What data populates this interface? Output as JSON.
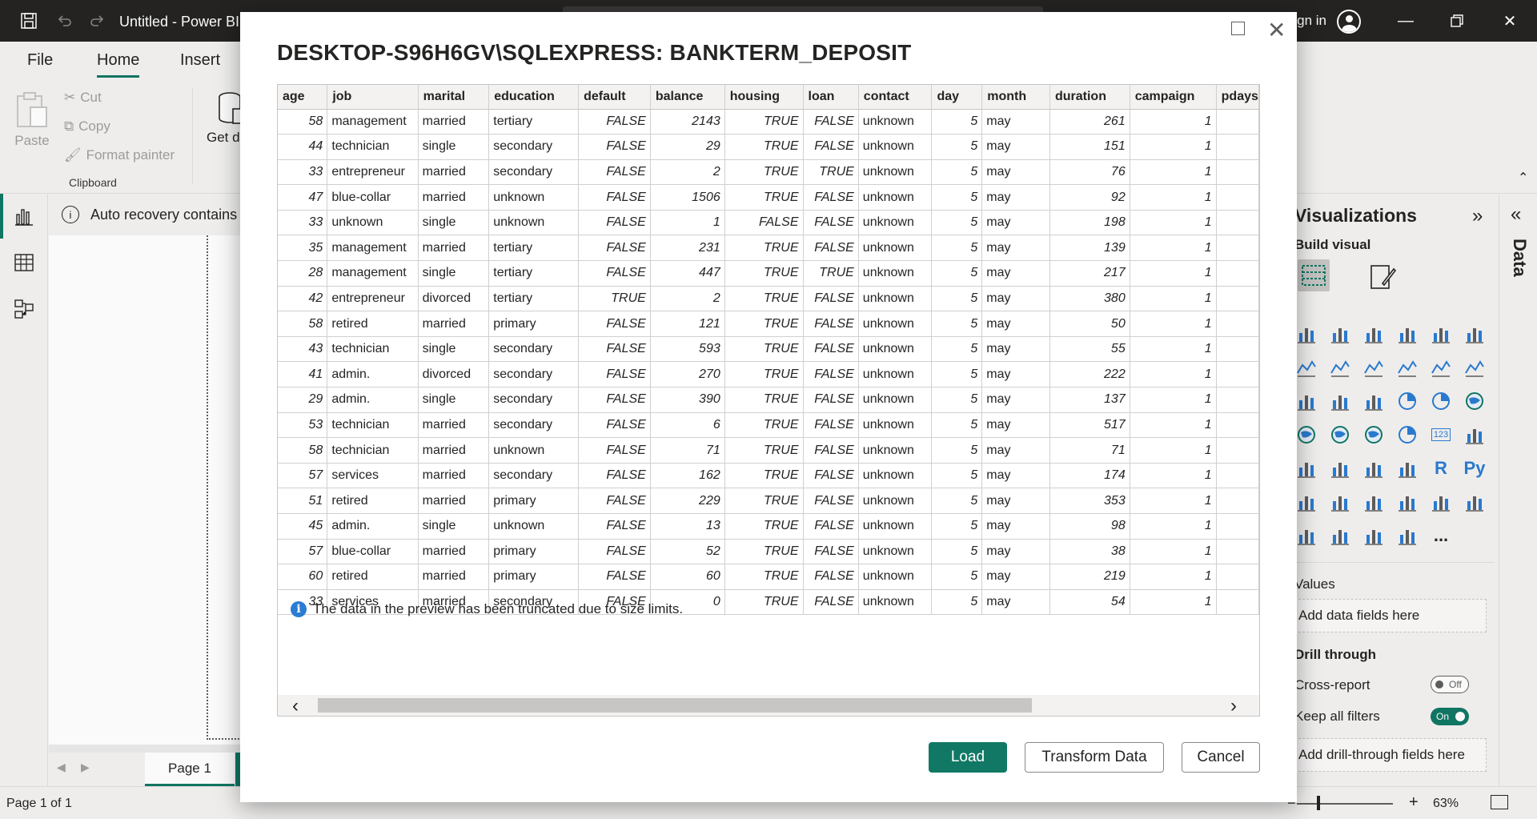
{
  "app": {
    "title": "Untitled - Power BI",
    "sign_in": "Sign in"
  },
  "ribbon": {
    "tabs": [
      "File",
      "Home",
      "Insert"
    ],
    "active_tab": "Home",
    "clipboard": {
      "paste": "Paste",
      "cut": "Cut",
      "copy": "Copy",
      "format_painter": "Format painter",
      "group_label": "Clipboard"
    },
    "get_data": "Get data"
  },
  "info_bar": {
    "text": "Auto recovery contains"
  },
  "pages": {
    "tabs": [
      "Page 1"
    ],
    "add_symbol": "+"
  },
  "status": {
    "page_count": "Page 1 of 1",
    "zoom": "63%"
  },
  "visualizations": {
    "title": "Visualizations",
    "build_visual": "Build visual",
    "values_label": "Values",
    "values_placeholder": "Add data fields here",
    "drill_through": "Drill through",
    "cross_report": "Cross-report",
    "cross_report_state": "Off",
    "keep_all_filters": "Keep all filters",
    "keep_all_filters_state": "On",
    "drill_placeholder": "Add drill-through fields here",
    "r_label": "R",
    "py_label": "Py",
    "more": "...",
    "num_icon": "123"
  },
  "data_pane": {
    "title": "Data"
  },
  "dialog": {
    "title": "DESKTOP-S96H6GV\\SQLEXPRESS: BANKTERM_DEPOSIT",
    "columns": [
      "age",
      "job",
      "marital",
      "education",
      "default",
      "balance",
      "housing",
      "loan",
      "contact",
      "day",
      "month",
      "duration",
      "campaign",
      "pdays"
    ],
    "rows": [
      [
        "58",
        "management",
        "married",
        "tertiary",
        "FALSE",
        "2143",
        "TRUE",
        "FALSE",
        "unknown",
        "5",
        "may",
        "261",
        "1",
        ""
      ],
      [
        "44",
        "technician",
        "single",
        "secondary",
        "FALSE",
        "29",
        "TRUE",
        "FALSE",
        "unknown",
        "5",
        "may",
        "151",
        "1",
        ""
      ],
      [
        "33",
        "entrepreneur",
        "married",
        "secondary",
        "FALSE",
        "2",
        "TRUE",
        "TRUE",
        "unknown",
        "5",
        "may",
        "76",
        "1",
        ""
      ],
      [
        "47",
        "blue-collar",
        "married",
        "unknown",
        "FALSE",
        "1506",
        "TRUE",
        "FALSE",
        "unknown",
        "5",
        "may",
        "92",
        "1",
        ""
      ],
      [
        "33",
        "unknown",
        "single",
        "unknown",
        "FALSE",
        "1",
        "FALSE",
        "FALSE",
        "unknown",
        "5",
        "may",
        "198",
        "1",
        ""
      ],
      [
        "35",
        "management",
        "married",
        "tertiary",
        "FALSE",
        "231",
        "TRUE",
        "FALSE",
        "unknown",
        "5",
        "may",
        "139",
        "1",
        ""
      ],
      [
        "28",
        "management",
        "single",
        "tertiary",
        "FALSE",
        "447",
        "TRUE",
        "TRUE",
        "unknown",
        "5",
        "may",
        "217",
        "1",
        ""
      ],
      [
        "42",
        "entrepreneur",
        "divorced",
        "tertiary",
        "TRUE",
        "2",
        "TRUE",
        "FALSE",
        "unknown",
        "5",
        "may",
        "380",
        "1",
        ""
      ],
      [
        "58",
        "retired",
        "married",
        "primary",
        "FALSE",
        "121",
        "TRUE",
        "FALSE",
        "unknown",
        "5",
        "may",
        "50",
        "1",
        ""
      ],
      [
        "43",
        "technician",
        "single",
        "secondary",
        "FALSE",
        "593",
        "TRUE",
        "FALSE",
        "unknown",
        "5",
        "may",
        "55",
        "1",
        ""
      ],
      [
        "41",
        "admin.",
        "divorced",
        "secondary",
        "FALSE",
        "270",
        "TRUE",
        "FALSE",
        "unknown",
        "5",
        "may",
        "222",
        "1",
        ""
      ],
      [
        "29",
        "admin.",
        "single",
        "secondary",
        "FALSE",
        "390",
        "TRUE",
        "FALSE",
        "unknown",
        "5",
        "may",
        "137",
        "1",
        ""
      ],
      [
        "53",
        "technician",
        "married",
        "secondary",
        "FALSE",
        "6",
        "TRUE",
        "FALSE",
        "unknown",
        "5",
        "may",
        "517",
        "1",
        ""
      ],
      [
        "58",
        "technician",
        "married",
        "unknown",
        "FALSE",
        "71",
        "TRUE",
        "FALSE",
        "unknown",
        "5",
        "may",
        "71",
        "1",
        ""
      ],
      [
        "57",
        "services",
        "married",
        "secondary",
        "FALSE",
        "162",
        "TRUE",
        "FALSE",
        "unknown",
        "5",
        "may",
        "174",
        "1",
        ""
      ],
      [
        "51",
        "retired",
        "married",
        "primary",
        "FALSE",
        "229",
        "TRUE",
        "FALSE",
        "unknown",
        "5",
        "may",
        "353",
        "1",
        ""
      ],
      [
        "45",
        "admin.",
        "single",
        "unknown",
        "FALSE",
        "13",
        "TRUE",
        "FALSE",
        "unknown",
        "5",
        "may",
        "98",
        "1",
        ""
      ],
      [
        "57",
        "blue-collar",
        "married",
        "primary",
        "FALSE",
        "52",
        "TRUE",
        "FALSE",
        "unknown",
        "5",
        "may",
        "38",
        "1",
        ""
      ],
      [
        "60",
        "retired",
        "married",
        "primary",
        "FALSE",
        "60",
        "TRUE",
        "FALSE",
        "unknown",
        "5",
        "may",
        "219",
        "1",
        ""
      ],
      [
        "33",
        "services",
        "married",
        "secondary",
        "FALSE",
        "0",
        "TRUE",
        "FALSE",
        "unknown",
        "5",
        "may",
        "54",
        "1",
        ""
      ]
    ],
    "truncation_note": "The data in the preview has been truncated due to size limits.",
    "buttons": {
      "load": "Load",
      "transform": "Transform Data",
      "cancel": "Cancel"
    }
  },
  "colors": {
    "accent": "#117865",
    "info": "#2b7cd3",
    "titlebar": "#252423"
  }
}
